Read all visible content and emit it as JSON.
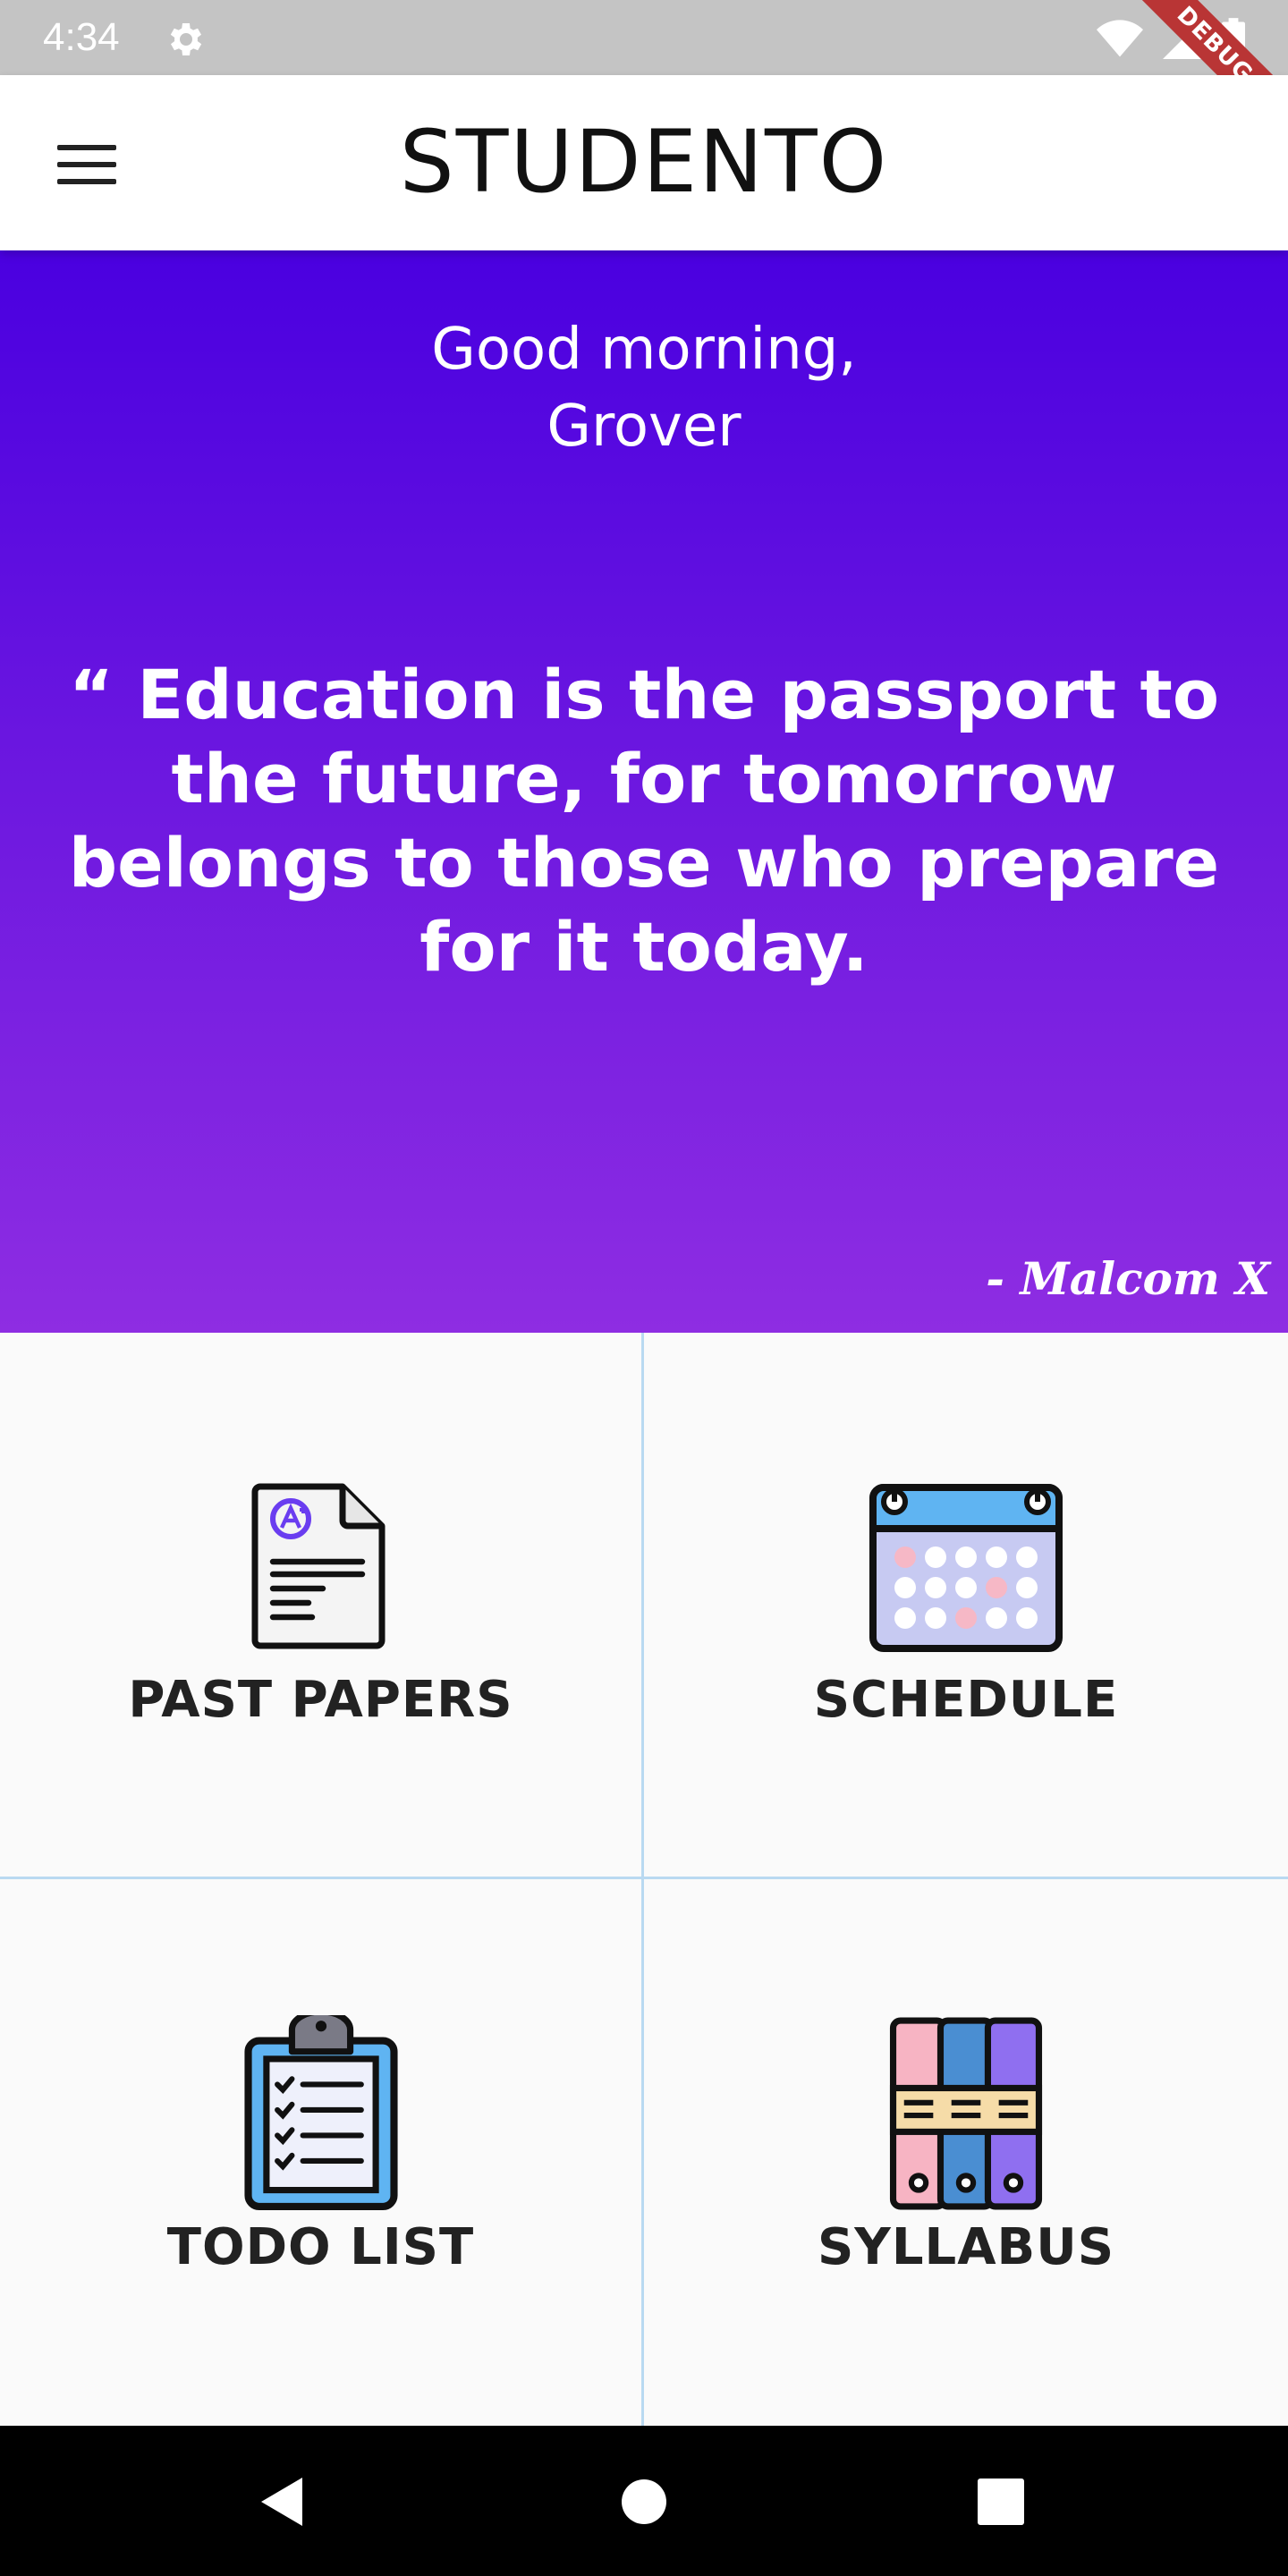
{
  "status_bar": {
    "time": "4:34",
    "icons": [
      "gear-icon",
      "wifi-icon",
      "cell-signal-icon",
      "battery-icon"
    ]
  },
  "debug_banner": "DEBUG",
  "app_bar": {
    "title": "STUDENTO",
    "menu_icon": "menu-icon"
  },
  "hero": {
    "greeting_line1": "Good morning,",
    "greeting_line2": "Grover",
    "quote": "“ Education is the passport to the future, for tomorrow belongs to those who prepare for it today.",
    "author": "- Malcom X",
    "gradient_top": "#4a00e0",
    "gradient_bottom": "#8e2de2"
  },
  "menu_tiles": [
    {
      "label": "PAST PAPERS",
      "icon": "exam-paper-icon"
    },
    {
      "label": "SCHEDULE",
      "icon": "calendar-icon"
    },
    {
      "label": "TODO LIST",
      "icon": "clipboard-checklist-icon"
    },
    {
      "label": "SYLLABUS",
      "icon": "binders-icon"
    }
  ],
  "nav_bar": {
    "buttons": [
      "back-icon",
      "home-icon",
      "recents-icon"
    ]
  }
}
